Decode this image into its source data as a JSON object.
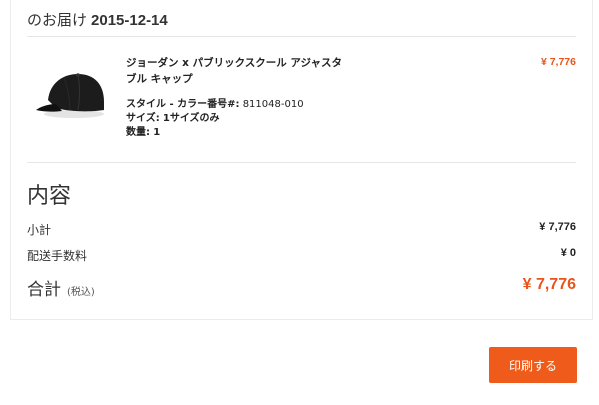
{
  "delivery": {
    "label": "のお届け",
    "date": "2015-12-14"
  },
  "product": {
    "name": "ジョーダン x パブリックスクール アジャスタブル キャップ",
    "price": "¥ 7,776",
    "image_icon": "cap-image",
    "style_label": "スタイル - カラー番号#:",
    "style_value": "811048-010",
    "size_label": "サイズ:",
    "size_value": "1サイズのみ",
    "qty_label": "数量:",
    "qty_value": "1"
  },
  "summary": {
    "title": "内容",
    "subtotal_label": "小計",
    "subtotal_value": "¥ 7,776",
    "shipping_label": "配送手数料",
    "shipping_value": "¥ 0",
    "total_label": "合計",
    "total_tax_note": "(税込)",
    "total_value": "¥ 7,776"
  },
  "actions": {
    "print_label": "印刷する"
  },
  "colors": {
    "accent": "#ee5b1a",
    "price": "#e8541c"
  }
}
